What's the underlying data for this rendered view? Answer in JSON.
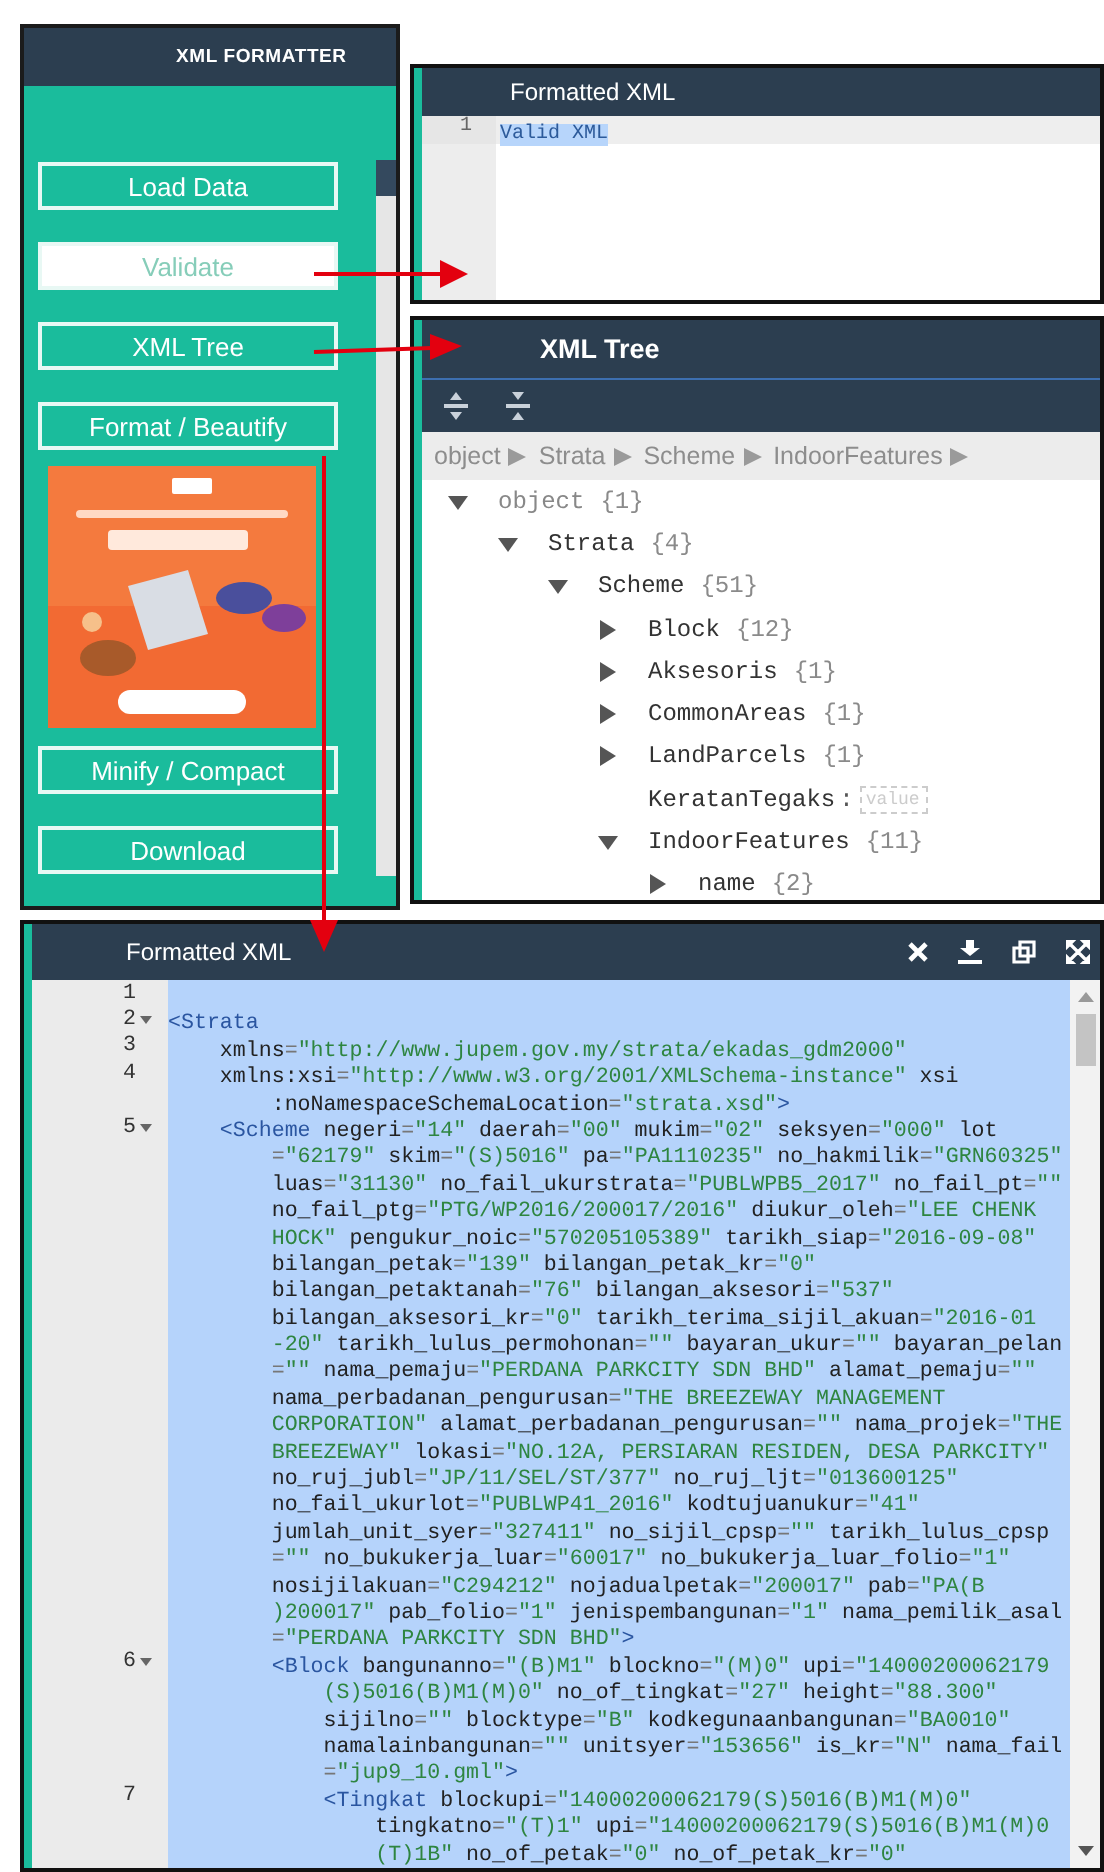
{
  "left_panel": {
    "title": "XML FORMATTER",
    "items": [
      {
        "kind": "button",
        "label": "Load Data",
        "selected": false
      },
      {
        "kind": "button",
        "label": "Validate",
        "selected": true
      },
      {
        "kind": "button",
        "label": "XML Tree",
        "selected": false
      },
      {
        "kind": "button",
        "label": "Format / Beautify",
        "selected": false
      },
      {
        "kind": "picture"
      },
      {
        "kind": "button",
        "label": "Minify / Compact",
        "selected": false
      },
      {
        "kind": "button",
        "label": "Download",
        "selected": false
      }
    ]
  },
  "validation_panel": {
    "title": "Formatted XML",
    "lines": [
      {
        "number": "1",
        "text": "Valid XML"
      }
    ]
  },
  "tree_panel": {
    "title": "XML Tree",
    "breadcrumb": [
      "object",
      "Strata",
      "Scheme",
      "IndoorFeatures"
    ],
    "tree": [
      {
        "kind": "object",
        "key": "object",
        "count": "{1}",
        "expanded": true,
        "children": [
          {
            "kind": "object",
            "key": "Strata",
            "count": "{4}",
            "expanded": true,
            "children": [
              {
                "kind": "object",
                "key": "Scheme",
                "count": "{51}",
                "expanded": true,
                "children": [
                  {
                    "kind": "object",
                    "key": "Block",
                    "count": "{12}",
                    "expanded": false
                  },
                  {
                    "kind": "object",
                    "key": "Aksesoris",
                    "count": "{1}",
                    "expanded": false
                  },
                  {
                    "kind": "object",
                    "key": "CommonAreas",
                    "count": "{1}",
                    "expanded": false
                  },
                  {
                    "kind": "object",
                    "key": "LandParcels",
                    "count": "{1}",
                    "expanded": false
                  },
                  {
                    "kind": "value",
                    "key": "KeratanTegaks",
                    "delimiter": ":",
                    "placeholder": "value"
                  },
                  {
                    "kind": "object",
                    "key": "IndoorFeatures",
                    "count": "{11}",
                    "expanded": true,
                    "children": [
                      {
                        "kind": "object",
                        "key": "name",
                        "count": "{2}",
                        "expanded": false
                      }
                    ]
                  }
                ]
              }
            ]
          }
        ]
      }
    ]
  },
  "editor": {
    "title": "Formatted XML",
    "lines": [
      {
        "number": "1",
        "foldable": false
      },
      {
        "number": "2",
        "foldable": true,
        "rows": [
          "<Strata"
        ]
      },
      {
        "number": "3",
        "foldable": false,
        "rows": [
          "    xmlns=\"http://www.jupem.gov.my/strata/ekadas_gdm2000\""
        ]
      },
      {
        "number": "4",
        "foldable": false,
        "rows": [
          "    xmlns:xsi=\"http://www.w3.org/2001/XMLSchema-instance\" xsi",
          "        :noNamespaceSchemaLocation=\"strata.xsd\">"
        ]
      },
      {
        "number": "5",
        "foldable": true,
        "rows": [
          "    <Scheme negeri=\"14\" daerah=\"00\" mukim=\"02\" seksyen=\"000\" lot",
          "        =\"62179\" skim=\"(S)5016\" pa=\"PA1110235\" no_hakmilik=\"GRN60325\"",
          "        luas=\"31130\" no_fail_ukurstrata=\"PUBLWPB5_2017\" no_fail_pt=\"\"",
          "        no_fail_ptg=\"PTG/WP2016/200017/2016\" diukur_oleh=\"LEE CHENK",
          "        HOCK\" pengukur_noic=\"570205105389\" tarikh_siap=\"2016-09-08\"",
          "        bilangan_petak=\"139\" bilangan_petak_kr=\"0\"",
          "        bilangan_petaktanah=\"76\" bilangan_aksesori=\"537\"",
          "        bilangan_aksesori_kr=\"0\" tarikh_terima_sijil_akuan=\"2016-01",
          "        -20\" tarikh_lulus_permohonan=\"\" bayaran_ukur=\"\" bayaran_pelan",
          "        =\"\" nama_pemaju=\"PERDANA PARKCITY SDN BHD\" alamat_pemaju=\"\"",
          "        nama_perbadanan_pengurusan=\"THE BREEZEWAY MANAGEMENT",
          "        CORPORATION\" alamat_perbadanan_pengurusan=\"\" nama_projek=\"THE",
          "        BREEZEWAY\" lokasi=\"NO.12A, PERSIARAN RESIDEN, DESA PARKCITY\"",
          "        no_ruj_jubl=\"JP/11/SEL/ST/377\" no_ruj_ljt=\"013600125\"",
          "        no_fail_ukurlot=\"PUBLWP41_2016\" kodtujuanukur=\"41\"",
          "        jumlah_unit_syer=\"327411\" no_sijil_cpsp=\"\" tarikh_lulus_cpsp",
          "        =\"\" no_bukukerja_luar=\"60017\" no_bukukerja_luar_folio=\"1\"",
          "        nosijilakuan=\"C294212\" nojadualpetak=\"200017\" pab=\"PA(B",
          "        )200017\" pab_folio=\"1\" jenispembangunan=\"1\" nama_pemilik_asal",
          "        =\"PERDANA PARKCITY SDN BHD\">"
        ]
      },
      {
        "number": "6",
        "foldable": true,
        "rows": [
          "        <Block bangunanno=\"(B)M1\" blockno=\"(M)0\" upi=\"14000200062179",
          "            (S)5016(B)M1(M)0\" no_of_tingkat=\"27\" height=\"88.300\"",
          "            sijilno=\"\" blocktype=\"B\" kodkegunaanbangunan=\"BA0010\"",
          "            namalainbangunan=\"\" unitsyer=\"153656\" is_kr=\"N\" nama_fail",
          "            =\"jup9_10.gml\">"
        ]
      },
      {
        "number": "7",
        "foldable": false,
        "rows": [
          "            <Tingkat blockupi=\"14000200062179(S)5016(B)M1(M)0\"",
          "                tingkatno=\"(T)1\" upi=\"14000200062179(S)5016(B)M1(M)0",
          "                (T)1B\" no_of_petak=\"0\" no_of_petak_kr=\"0\""
        ]
      }
    ]
  }
}
